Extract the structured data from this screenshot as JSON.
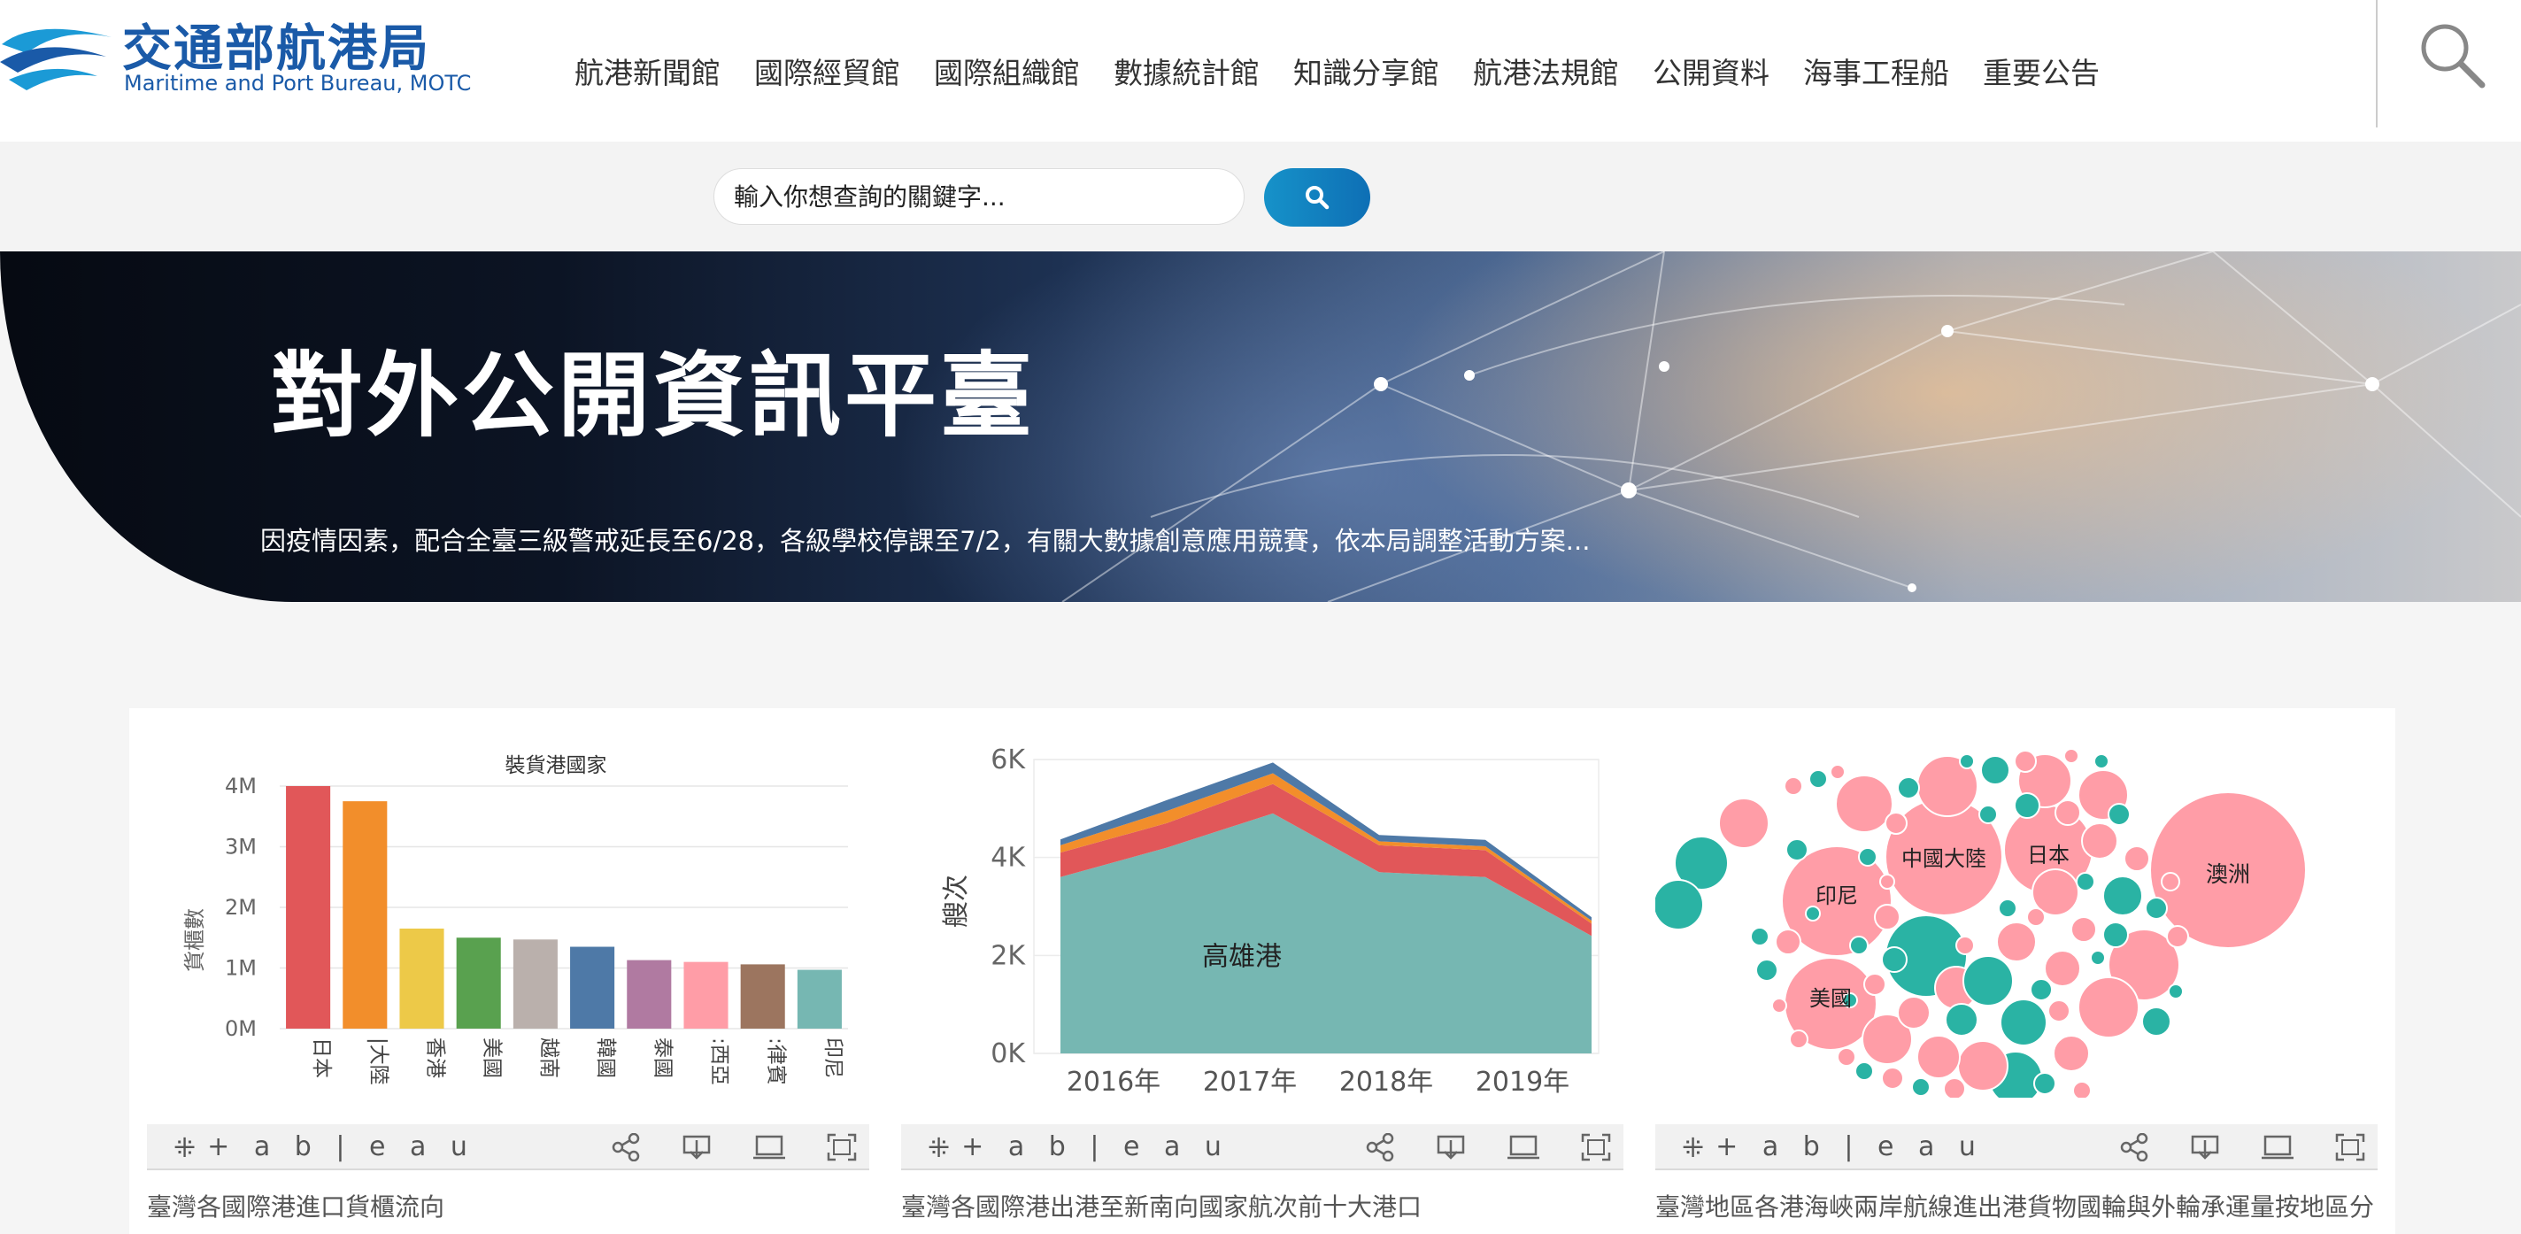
{
  "header": {
    "logo_zh": "交通部航港局",
    "logo_en": "Maritime and Port Bureau, MOTC",
    "nav": [
      "航港新聞館",
      "國際經貿館",
      "國際組織館",
      "數據統計館",
      "知識分享館",
      "航港法規館",
      "公開資料",
      "海事工程船",
      "重要公告"
    ]
  },
  "search": {
    "placeholder": "輸入你想查詢的關鍵字..."
  },
  "banner": {
    "title": "對外公開資訊平臺",
    "subtitle": "因疫情因素，配合全臺三級警戒延長至6/28，各級學校停課至7/2，有關大數據創意應用競賽，依本局調整活動方案..."
  },
  "toolbar": {
    "brand": "+ a b | e a u"
  },
  "cards": [
    {
      "caption": "臺灣各國際港進口貨櫃流向"
    },
    {
      "caption": "臺灣各國際港出港至新南向國家航次前十大港口"
    },
    {
      "caption": "臺灣地區各港海峽兩岸航線進出港貨物國輪與外輪承運量按地區分"
    }
  ],
  "chart_data": [
    {
      "type": "bar",
      "title": "裝貨港國家",
      "ylabel": "貨櫃數",
      "categories": [
        "日本",
        "中國大陸",
        "香港",
        "美國",
        "越南",
        "韓國",
        "泰國",
        "馬來西亞",
        "菲律賓",
        "印尼"
      ],
      "category_labels_shown": [
        "日本",
        "|大陸",
        "香港",
        "美國",
        "越南",
        "韓國",
        "泰國",
        ":西亞",
        ":律賓",
        "印尼"
      ],
      "values": [
        4000000,
        3750000,
        1650000,
        1500000,
        1470000,
        1350000,
        1130000,
        1100000,
        1060000,
        970000
      ],
      "colors": [
        "#e15759",
        "#f28e2b",
        "#edc948",
        "#59a14f",
        "#bab0ac",
        "#4e79a7",
        "#b07aa1",
        "#ff9da7",
        "#9c755f",
        "#76b7b2"
      ],
      "yticks": [
        "0M",
        "1M",
        "2M",
        "3M",
        "4M"
      ],
      "ylim": [
        0,
        4000000
      ]
    },
    {
      "type": "area",
      "ylabel": "艘次",
      "x": [
        "2016年",
        "2017年",
        "2018年",
        "2019年"
      ],
      "x_positions": [
        0,
        0.2,
        0.4,
        0.6,
        0.8,
        1.0
      ],
      "yticks": [
        "0K",
        "2K",
        "4K",
        "6K"
      ],
      "ylim": [
        0,
        6000
      ],
      "series": [
        {
          "name": "高雄港",
          "color": "#76b7b2",
          "values": [
            3600,
            4200,
            4900,
            3700,
            3600,
            2400
          ]
        },
        {
          "color": "#e15759",
          "values": [
            500,
            500,
            600,
            550,
            550,
            250
          ]
        },
        {
          "color": "#f28e2b",
          "values": [
            150,
            250,
            220,
            80,
            80,
            60
          ]
        },
        {
          "color": "#4e79a7",
          "values": [
            120,
            220,
            220,
            130,
            130,
            70
          ]
        }
      ],
      "annotation": "高雄港"
    },
    {
      "type": "bubble",
      "labels": [
        "澳洲",
        "中國大陸",
        "日本",
        "印尼",
        "美國"
      ],
      "colors": {
        "pink": "#ff9da7",
        "teal": "#2ab3a4"
      }
    }
  ]
}
